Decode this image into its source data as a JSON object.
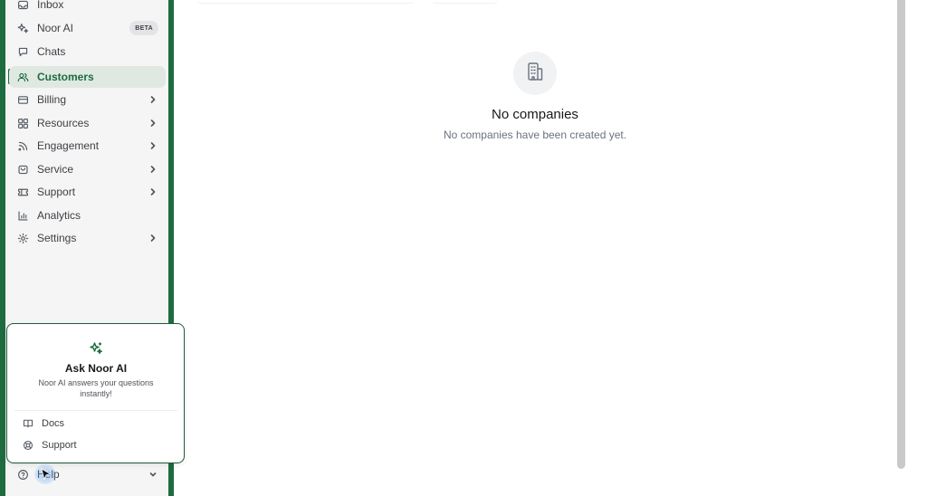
{
  "sidebar": {
    "items": [
      {
        "label": "Inbox",
        "icon": "inbox-icon",
        "chevron": false
      },
      {
        "label": "Noor AI",
        "icon": "sparkle-icon",
        "badge": "BETA"
      },
      {
        "label": "Chats",
        "icon": "chat-icon",
        "chevron": false
      },
      {
        "label": "Customers",
        "icon": "users-icon",
        "chevron": false,
        "active": true
      },
      {
        "label": "Billing",
        "icon": "credit-card-icon",
        "chevron": true
      },
      {
        "label": "Resources",
        "icon": "grid-icon",
        "chevron": true
      },
      {
        "label": "Engagement",
        "icon": "rss-icon",
        "chevron": true
      },
      {
        "label": "Service",
        "icon": "bag-icon",
        "chevron": true
      },
      {
        "label": "Support",
        "icon": "ticket-icon",
        "chevron": true
      },
      {
        "label": "Analytics",
        "icon": "bar-chart-icon",
        "chevron": false
      },
      {
        "label": "Settings",
        "icon": "gear-icon",
        "chevron": true
      }
    ],
    "help": {
      "label": "Help",
      "icon": "help-circle-icon"
    }
  },
  "main": {
    "empty_state": {
      "icon": "building-icon",
      "title": "No companies",
      "subtitle": "No companies have been created yet."
    }
  },
  "popup": {
    "icon": "sparkle-icon",
    "title": "Ask Noor AI",
    "description": "Noor AI answers your questions instantly!",
    "links": [
      {
        "label": "Docs",
        "icon": "book-icon"
      },
      {
        "label": "Support",
        "icon": "lifebuoy-icon"
      }
    ]
  },
  "colors": {
    "brand": "#1d6b3f",
    "active_bg": "#dfe9e2",
    "sidebar_bg": "#f4f5f4"
  }
}
